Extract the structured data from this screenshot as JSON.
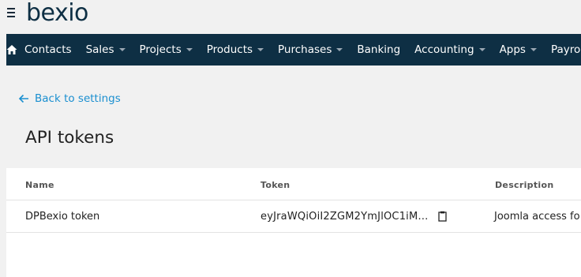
{
  "brand": {
    "logo_text": "bexio"
  },
  "nav": {
    "home_icon": "home-icon",
    "items": [
      {
        "label": "Contacts",
        "dropdown": false
      },
      {
        "label": "Sales",
        "dropdown": true
      },
      {
        "label": "Projects",
        "dropdown": true
      },
      {
        "label": "Products",
        "dropdown": true
      },
      {
        "label": "Purchases",
        "dropdown": true
      },
      {
        "label": "Banking",
        "dropdown": false
      },
      {
        "label": "Accounting",
        "dropdown": true
      },
      {
        "label": "Apps",
        "dropdown": true
      },
      {
        "label": "Payroll",
        "external": true
      }
    ]
  },
  "back_link": {
    "label": "Back to settings"
  },
  "page": {
    "title": "API tokens"
  },
  "table": {
    "columns": [
      "Name",
      "Token",
      "Description"
    ],
    "rows": [
      {
        "name": "DPBexio token",
        "token": "eyJraWQiOiI2ZGM2YmJlOC1iM…",
        "description": "Joomla access fo"
      }
    ]
  },
  "colors": {
    "navbar": "#0e2f44",
    "link": "#1a8fd0",
    "background": "#f1f1f1"
  }
}
